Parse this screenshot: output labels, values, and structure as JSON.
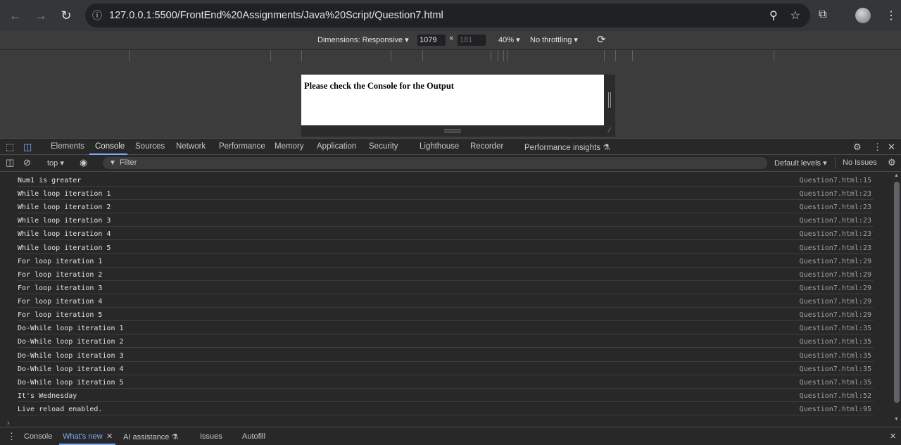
{
  "browser": {
    "url": "127.0.0.1:5500/FrontEnd%20Assignments/Java%20Script/Question7.html",
    "icons": [
      "back-icon",
      "forward-icon",
      "reload-icon",
      "site-info-icon",
      "zoom-icon",
      "bookmark-star-icon",
      "extensions-icon",
      "profile-avatar",
      "menu-kebab-icon"
    ]
  },
  "device_toolbar": {
    "dimensions_label": "Dimensions: Responsive",
    "width": "1079",
    "times": "×",
    "height": "181",
    "zoom": "40%",
    "throttling": "No throttling"
  },
  "page": {
    "heading": "Please check the Console for the Output"
  },
  "devtools": {
    "tabs": [
      "Elements",
      "Console",
      "Sources",
      "Network",
      "Performance",
      "Memory",
      "Application",
      "Security",
      "Lighthouse",
      "Recorder",
      "Performance insights"
    ],
    "active_tab": "Console"
  },
  "console_toolbar": {
    "context": "top",
    "filter_placeholder": "Filter",
    "levels": "Default levels",
    "issues": "No Issues"
  },
  "console_rows": [
    {
      "msg": "Num1 is greater",
      "src": "Question7.html:15"
    },
    {
      "msg": "While loop iteration 1",
      "src": "Question7.html:23"
    },
    {
      "msg": "While loop iteration 2",
      "src": "Question7.html:23"
    },
    {
      "msg": "While loop iteration 3",
      "src": "Question7.html:23"
    },
    {
      "msg": "While loop iteration 4",
      "src": "Question7.html:23"
    },
    {
      "msg": "While loop iteration 5",
      "src": "Question7.html:23"
    },
    {
      "msg": "For loop iteration 1",
      "src": "Question7.html:29"
    },
    {
      "msg": "For loop iteration 2",
      "src": "Question7.html:29"
    },
    {
      "msg": "For loop iteration 3",
      "src": "Question7.html:29"
    },
    {
      "msg": "For loop iteration 4",
      "src": "Question7.html:29"
    },
    {
      "msg": "For loop iteration 5",
      "src": "Question7.html:29"
    },
    {
      "msg": "Do-While loop iteration 1",
      "src": "Question7.html:35"
    },
    {
      "msg": "Do-While loop iteration 2",
      "src": "Question7.html:35"
    },
    {
      "msg": "Do-While loop iteration 3",
      "src": "Question7.html:35"
    },
    {
      "msg": "Do-While loop iteration 4",
      "src": "Question7.html:35"
    },
    {
      "msg": "Do-While loop iteration 5",
      "src": "Question7.html:35"
    },
    {
      "msg": "It's Wednesday",
      "src": "Question7.html:52"
    },
    {
      "msg": "Live reload enabled.",
      "src": "Question7.html:95"
    }
  ],
  "drawer": {
    "tabs": [
      "Console",
      "What's new",
      "AI assistance",
      "Issues",
      "Autofill"
    ],
    "active_tab": "What's new"
  },
  "colors": {
    "accent": "#7cacf8",
    "panel": "#282828",
    "toolbar": "#35363a"
  }
}
